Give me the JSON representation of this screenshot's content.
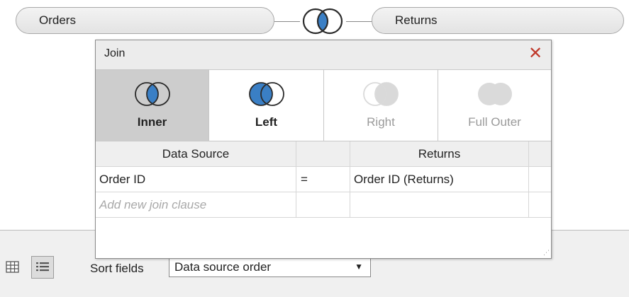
{
  "join_bar": {
    "left_table": "Orders",
    "right_table": "Returns",
    "join_icon": "venn-inner-join-icon"
  },
  "dialog": {
    "title": "Join",
    "close_icon": "close-icon",
    "join_types": [
      {
        "label": "Inner",
        "icon": "venn-inner-icon",
        "selected": true,
        "enabled": true
      },
      {
        "label": "Left",
        "icon": "venn-left-icon",
        "selected": false,
        "enabled": true
      },
      {
        "label": "Right",
        "icon": "venn-right-icon",
        "selected": false,
        "enabled": false
      },
      {
        "label": "Full Outer",
        "icon": "venn-full-outer-icon",
        "selected": false,
        "enabled": false
      }
    ],
    "columns": {
      "left": "Data Source",
      "right": "Returns"
    },
    "clauses": [
      {
        "left": "Order ID",
        "operator": "=",
        "right": "Order ID (Returns)"
      }
    ],
    "add_clause_placeholder": "Add new join clause"
  },
  "bottom_bar": {
    "grid_view_icon": "grid-view-icon",
    "list_view_icon": "list-view-icon",
    "sort_label": "Sort fields",
    "sort_value": "Data source order",
    "sort_arrow_icon": "dropdown-arrow-icon"
  },
  "colors": {
    "venn_blue": "#3a7fc5",
    "selected_tile": "#cdcdcd",
    "close_red": "#c0392b",
    "disabled_text": "#9a9a9a"
  }
}
